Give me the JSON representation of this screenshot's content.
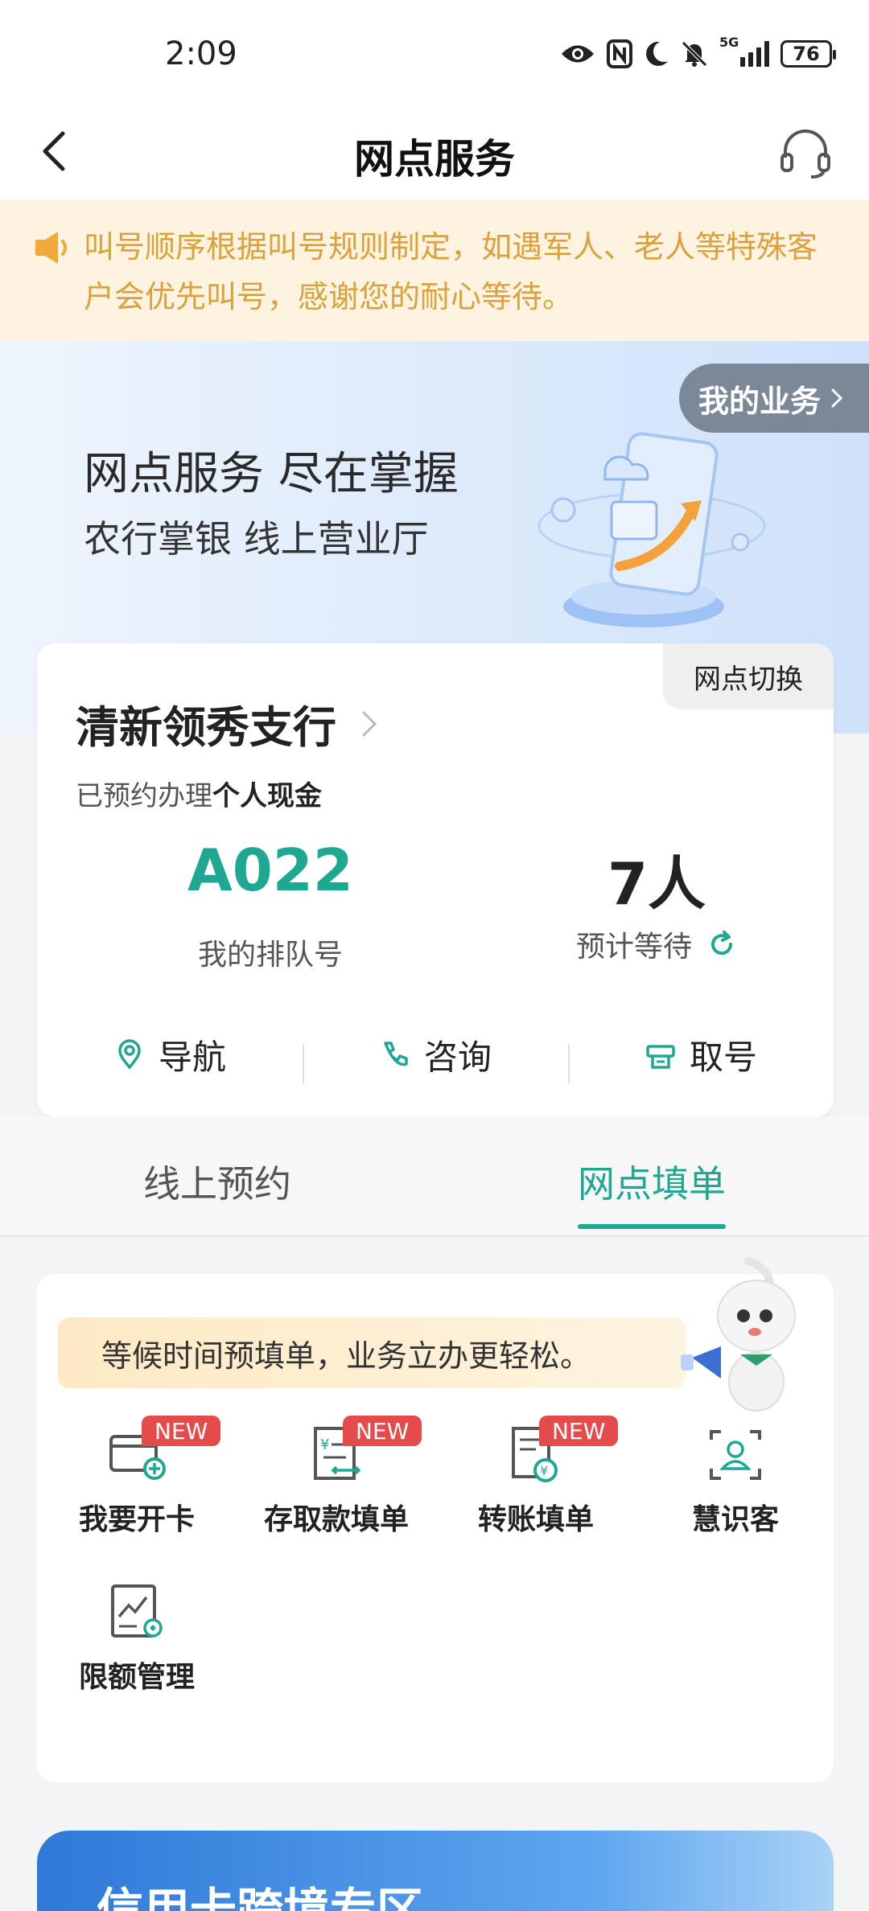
{
  "status_bar": {
    "time": "2:09",
    "network": "5G",
    "battery": "76"
  },
  "header": {
    "title": "网点服务"
  },
  "notice": {
    "text": "叫号顺序根据叫号规则制定，如遇军人、老人等特殊客户会优先叫号，感谢您的耐心等待。"
  },
  "banner": {
    "title": "网点服务 尽在掌握",
    "subtitle": "农行掌银 线上营业厅",
    "my_business": "我的业务"
  },
  "branch": {
    "switch_label": "网点切换",
    "name": "清新领秀支行",
    "booked_prefix": "已预约办理",
    "booked_service": "个人现金",
    "queue_number": "A022",
    "queue_label": "我的排队号",
    "wait_count": "7人",
    "wait_label": "预计等待",
    "actions": [
      {
        "label": "导航",
        "icon": "location-icon"
      },
      {
        "label": "咨询",
        "icon": "phone-icon"
      },
      {
        "label": "取号",
        "icon": "ticket-icon"
      }
    ]
  },
  "tabs": [
    {
      "label": "线上预约",
      "active": false
    },
    {
      "label": "网点填单",
      "active": true
    }
  ],
  "fill_section": {
    "hint": "等候时间预填单，业务立办更轻松。",
    "services": [
      {
        "label": "我要开卡",
        "badge": "NEW",
        "icon": "card-add-icon"
      },
      {
        "label": "存取款填单",
        "badge": "NEW",
        "icon": "deposit-form-icon"
      },
      {
        "label": "转账填单",
        "badge": "NEW",
        "icon": "transfer-form-icon"
      },
      {
        "label": "慧识客",
        "badge": "",
        "icon": "face-scan-icon"
      },
      {
        "label": "限额管理",
        "badge": "",
        "icon": "limit-chart-icon"
      }
    ]
  },
  "credit_banner": {
    "title": "信用卡跨境专区"
  },
  "colors": {
    "accent": "#1fa891",
    "notice_text": "#d9a23a",
    "notice_bg": "#fdf3e0",
    "badge": "#e64b4b"
  }
}
